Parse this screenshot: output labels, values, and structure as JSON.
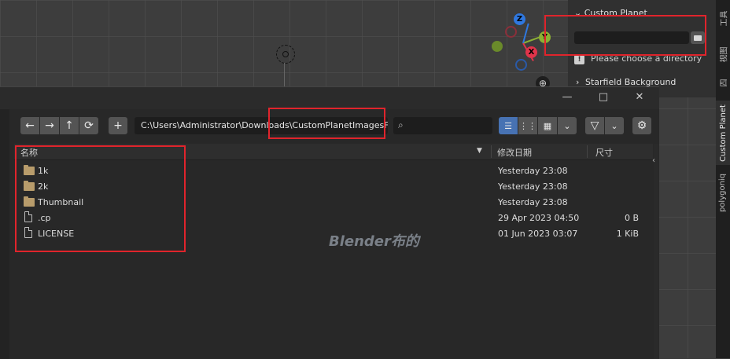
{
  "npanel": {
    "header": "Custom Planet",
    "warning": "Please choose a directory",
    "subsection": "Starfield Background"
  },
  "vtabs": [
    "工具",
    "视图",
    "四",
    "Custom Planet",
    "polygoniq"
  ],
  "gizmo": {
    "z": "Z",
    "y": "Y",
    "x": "X"
  },
  "window": {
    "minimize": "—",
    "maximize": "□",
    "close": "✕"
  },
  "toolbar": {
    "back": "←",
    "forward": "→",
    "parent": "↑",
    "refresh": "⟳",
    "new_folder": "+",
    "path": "C:\\Users\\Administrator\\Downloads\\CustomPlanetImagesFree\\",
    "search_icon": "⌕",
    "filter_icon": "▽",
    "settings_icon": "⚙"
  },
  "columns": {
    "name": "名称",
    "modified": "修改日期",
    "size": "尺寸"
  },
  "files": [
    {
      "name": "1k",
      "type": "folder",
      "modified": "Yesterday 23:08",
      "size": ""
    },
    {
      "name": "2k",
      "type": "folder",
      "modified": "Yesterday 23:08",
      "size": ""
    },
    {
      "name": "Thumbnail",
      "type": "folder",
      "modified": "Yesterday 23:08",
      "size": ""
    },
    {
      "name": ".cp",
      "type": "file",
      "modified": "29 Apr 2023 04:50",
      "size": "0 B"
    },
    {
      "name": "LICENSE",
      "type": "file",
      "modified": "01 Jun 2023 03:07",
      "size": "1 KiB"
    }
  ],
  "watermark": "Blender布的",
  "colors": {
    "accent": "#4772b3",
    "highlight_box": "#e0242c"
  }
}
